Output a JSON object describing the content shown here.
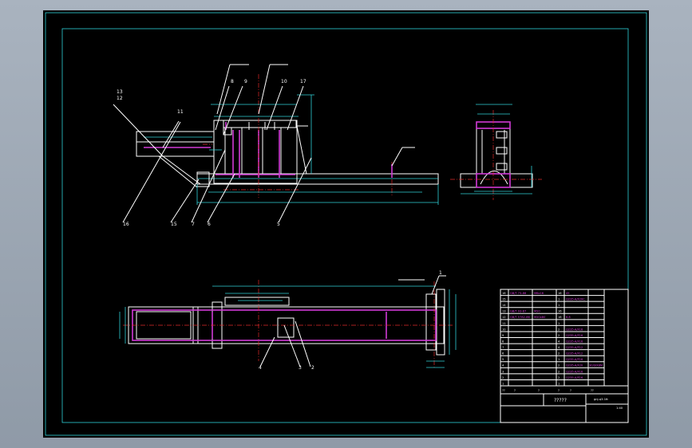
{
  "drawing": {
    "part_labels": [
      {
        "text": "13"
      },
      {
        "text": "12"
      },
      {
        "text": "11"
      },
      {
        "text": "8"
      },
      {
        "text": "9"
      },
      {
        "text": "10"
      },
      {
        "text": "17"
      },
      {
        "text": "16"
      },
      {
        "text": "15"
      },
      {
        "text": "7"
      },
      {
        "text": "6"
      },
      {
        "text": "5"
      },
      {
        "text": "1"
      },
      {
        "text": "4"
      },
      {
        "text": "3"
      },
      {
        "text": "2"
      }
    ]
  },
  "title_block": {
    "drawing_number": "gnj-q3-1tt",
    "drawing_name": "?????",
    "scale": "1:40",
    "bom_rows": [
      {
        "no": "16",
        "code": "GB/T 73-86",
        "name": "M6x16",
        "qty": "16",
        "mat": "45",
        "note": ""
      },
      {
        "no": "15",
        "code": "",
        "name": "",
        "qty": "1",
        "mat": "Q235-A/F20C",
        "note": ""
      },
      {
        "no": "14",
        "code": "",
        "name": "",
        "qty": "1",
        "mat": "",
        "note": ""
      },
      {
        "no": "13",
        "code": "GB/T 93-87",
        "name": "M20",
        "qty": "16",
        "mat": "",
        "note": ""
      },
      {
        "no": "12",
        "code": "GB/T 5782-86",
        "name": "M20x80",
        "qty": "16",
        "mat": "8.8",
        "note": ""
      },
      {
        "no": "11",
        "code": "",
        "name": "",
        "qty": "1",
        "mat": "",
        "note": ""
      },
      {
        "no": "10",
        "code": "",
        "name": "",
        "qty": "2",
        "mat": "Q235-A/F16",
        "note": ""
      },
      {
        "no": "9",
        "code": "",
        "name": "",
        "qty": "2",
        "mat": "Q235-A/F16",
        "note": ""
      },
      {
        "no": "8",
        "code": "",
        "name": "",
        "qty": "4",
        "mat": "Q235-A/F16",
        "note": ""
      },
      {
        "no": "7",
        "code": "",
        "name": "",
        "qty": "4",
        "mat": "Q235-A/F12",
        "note": ""
      },
      {
        "no": "6",
        "code": "",
        "name": "",
        "qty": "2",
        "mat": "Q235-A/F12",
        "note": ""
      },
      {
        "no": "5",
        "code": "",
        "name": "",
        "qty": "1",
        "mat": "Q235-A/F16",
        "note": ""
      },
      {
        "no": "4",
        "code": "",
        "name": "",
        "qty": "2",
        "mat": "Q235-A/F20",
        "note": "30/SIX8M"
      },
      {
        "no": "3",
        "code": "",
        "name": "",
        "qty": "2",
        "mat": "Q235-A/F16",
        "note": ""
      },
      {
        "no": "2",
        "code": "",
        "name": "",
        "qty": "2",
        "mat": "Q235-A/F16",
        "note": ""
      },
      {
        "no": "1",
        "code": "",
        "name": "",
        "qty": "1",
        "mat": "",
        "note": ""
      }
    ],
    "header_cells": [
      "??",
      "?",
      "?",
      "?",
      "?",
      "??"
    ]
  },
  "colors": {
    "background": "#000000",
    "frame": "#2fd0d6",
    "outline": "#ffffff",
    "hidden": "#d13ad6",
    "centerline": "#e02a2a",
    "dimension": "#2fd0d6"
  }
}
